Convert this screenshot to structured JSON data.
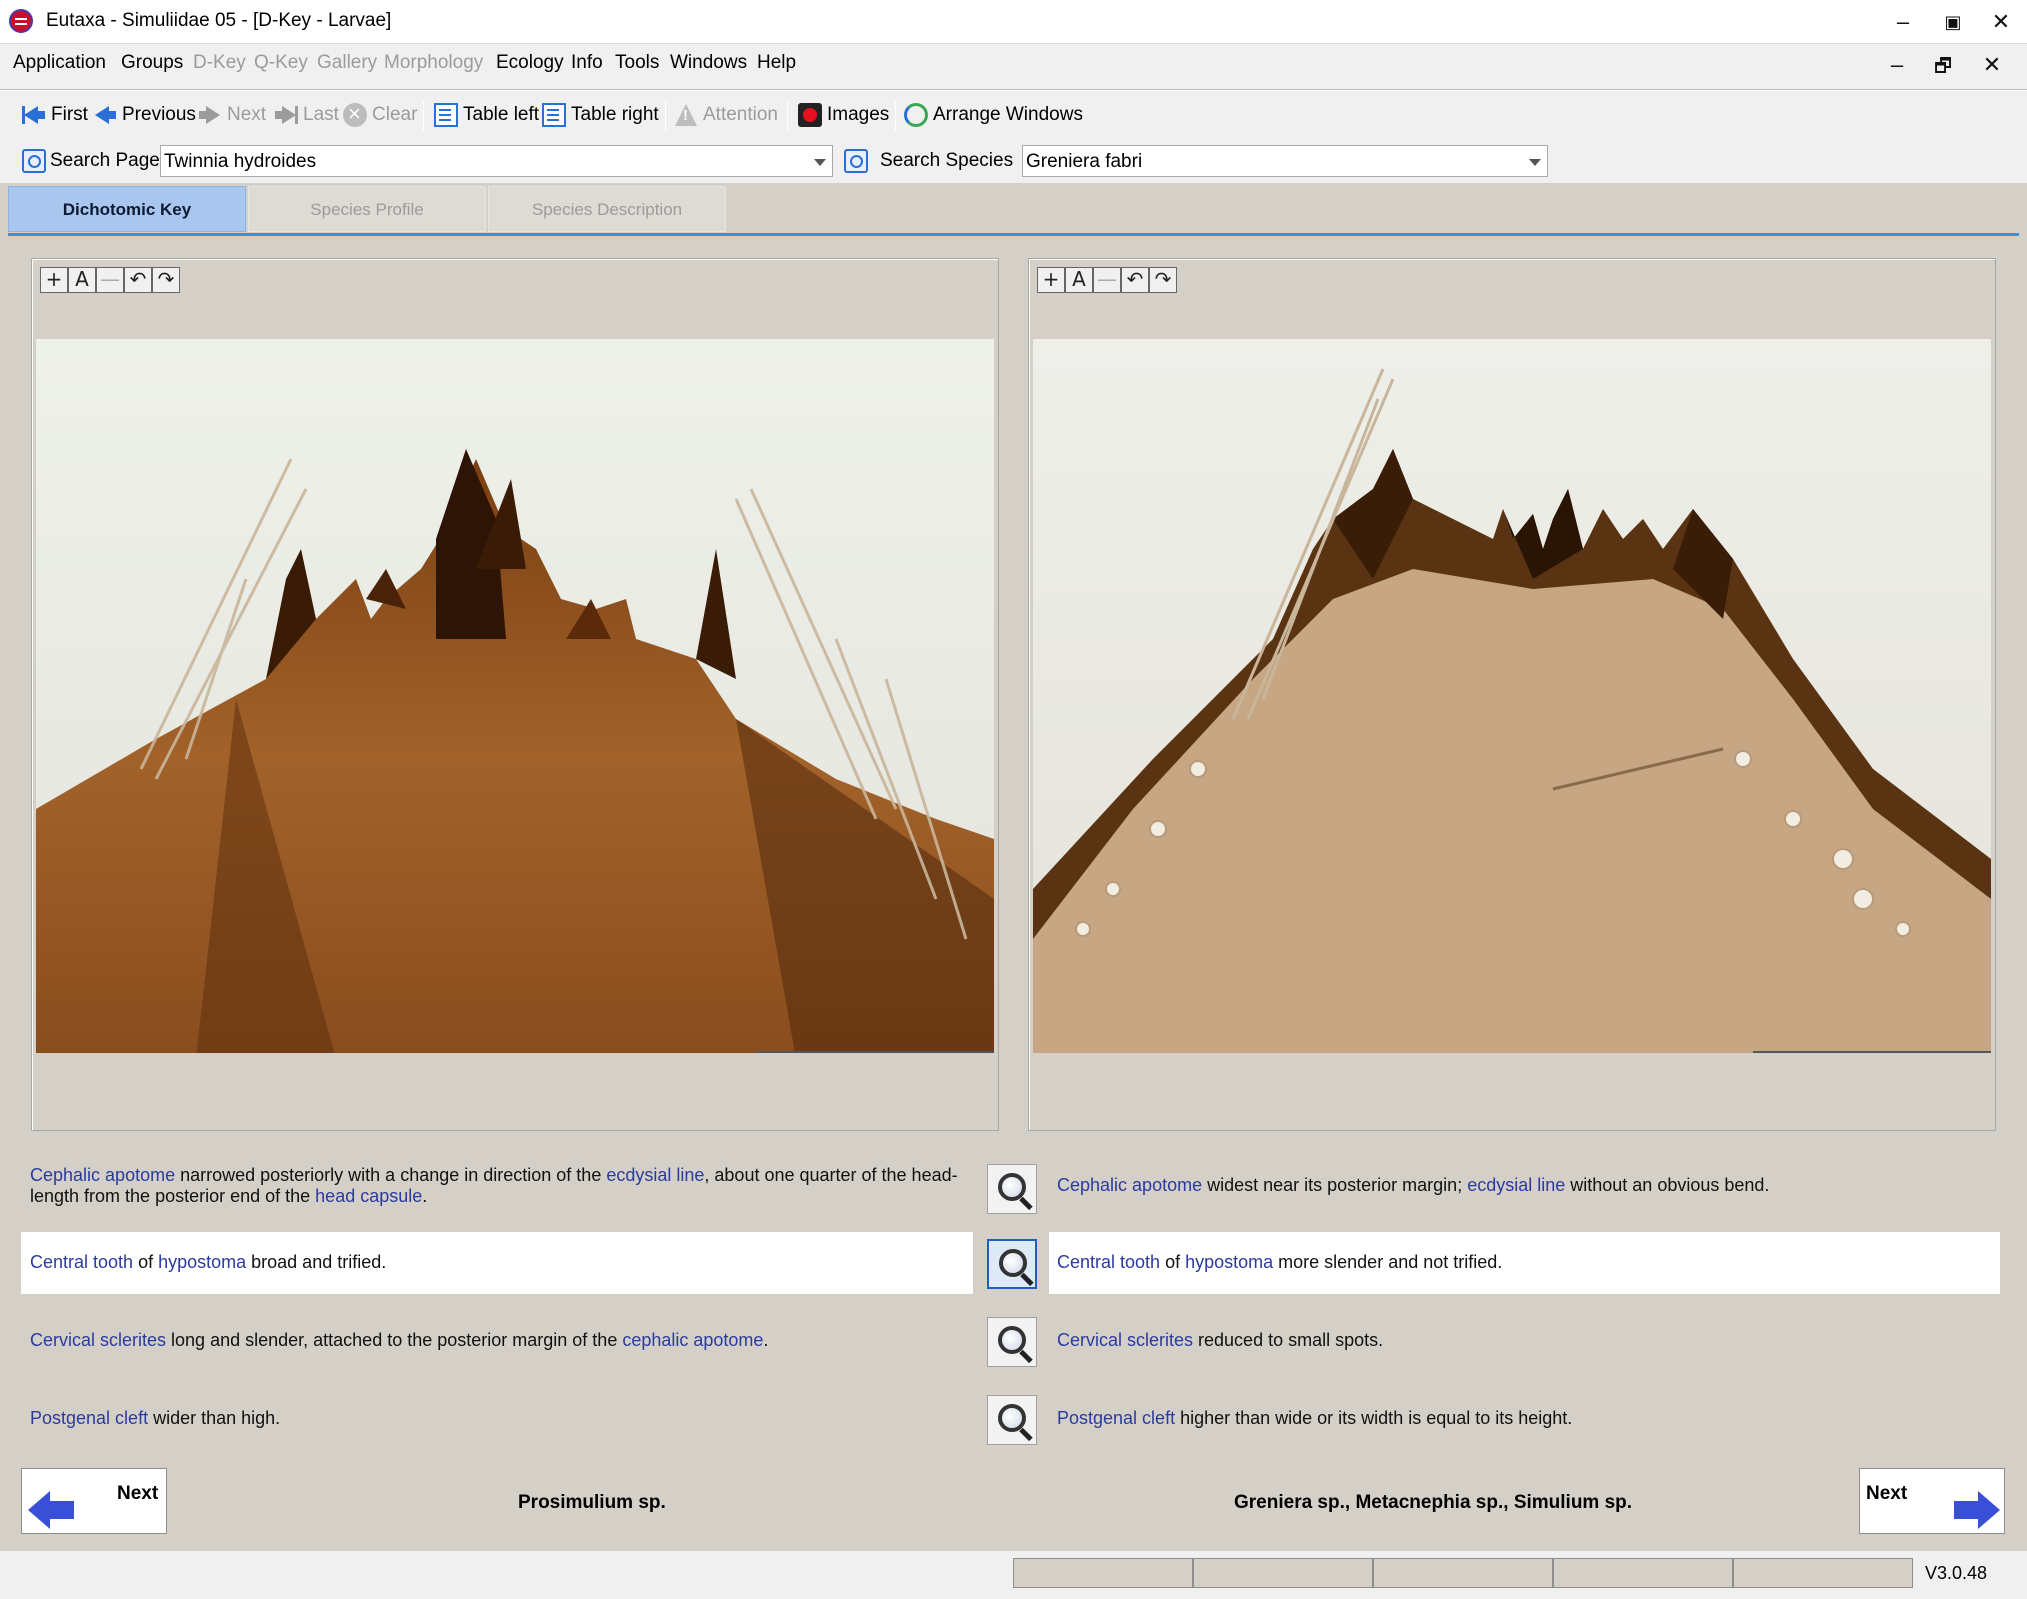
{
  "window": {
    "title": "Eutaxa - Simuliidae 05 - [D-Key - Larvae]",
    "minimize": "–",
    "maximize": "▣",
    "close": "✕"
  },
  "menu": {
    "items": [
      {
        "label": "Application",
        "enabled": true
      },
      {
        "label": "Groups",
        "enabled": true
      },
      {
        "label": "D-Key",
        "enabled": false
      },
      {
        "label": "Q-Key",
        "enabled": false
      },
      {
        "label": "Gallery",
        "enabled": false
      },
      {
        "label": "Morphology",
        "enabled": false
      },
      {
        "label": "Ecology",
        "enabled": true
      },
      {
        "label": "Info",
        "enabled": true
      },
      {
        "label": "Tools",
        "enabled": true
      },
      {
        "label": "Windows",
        "enabled": true
      },
      {
        "label": "Help",
        "enabled": true
      }
    ],
    "mdi": {
      "minimize": "–",
      "restore": "🗗",
      "close": "✕"
    }
  },
  "toolbar": {
    "first": "First",
    "previous": "Previous",
    "next": "Next",
    "last": "Last",
    "clear": "Clear",
    "table_left": "Table left",
    "table_right": "Table right",
    "attention": "Attention",
    "images": "Images",
    "arrange": "Arrange Windows"
  },
  "search": {
    "page_label": "Search Page",
    "page_value": "Twinnia hydroides",
    "species_label": "Search Species",
    "species_value": "Greniera fabri"
  },
  "tabs": [
    {
      "label": "Dichotomic Key",
      "active": true
    },
    {
      "label": "Species Profile",
      "active": false
    },
    {
      "label": "Species Description",
      "active": false
    }
  ],
  "zoom_tools": {
    "zoom_in": "+",
    "auto": "A",
    "zoom_out": "—",
    "rotate_left": "↶",
    "rotate_right": "↷"
  },
  "key": {
    "left": [
      [
        {
          "t": "Cephalic apotome",
          "link": true
        },
        {
          "t": " narrowed posteriorly with a change in direction of the ",
          "link": false
        },
        {
          "t": "ecdysial line",
          "link": true
        },
        {
          "t": ", about one quarter of the head-length from the posterior end of the ",
          "link": false
        },
        {
          "t": "head capsule",
          "link": true
        },
        {
          "t": ".",
          "link": false
        }
      ],
      [
        {
          "t": "Central tooth",
          "link": true
        },
        {
          "t": " of ",
          "link": false
        },
        {
          "t": "hypostoma",
          "link": true
        },
        {
          "t": " broad and trified.",
          "link": false
        }
      ],
      [
        {
          "t": "Cervical sclerites",
          "link": true
        },
        {
          "t": " long and slender, attached to the posterior margin of the ",
          "link": false
        },
        {
          "t": "cephalic apotome",
          "link": true
        },
        {
          "t": ".",
          "link": false
        }
      ],
      [
        {
          "t": "Postgenal cleft",
          "link": true
        },
        {
          "t": " wider than high.",
          "link": false
        }
      ]
    ],
    "right": [
      [
        {
          "t": "Cephalic apotome",
          "link": true
        },
        {
          "t": " widest near its posterior margin; ",
          "link": false
        },
        {
          "t": "ecdysial line",
          "link": true
        },
        {
          "t": " without an obvious bend.",
          "link": false
        }
      ],
      [
        {
          "t": "Central tooth",
          "link": true
        },
        {
          "t": " of ",
          "link": false
        },
        {
          "t": "hypostoma",
          "link": true
        },
        {
          "t": " more slender and not trified.",
          "link": false
        }
      ],
      [
        {
          "t": "Cervical sclerites",
          "link": true
        },
        {
          "t": " reduced to small spots.",
          "link": false
        }
      ],
      [
        {
          "t": "Postgenal cleft",
          "link": true
        },
        {
          "t": " higher than wide or its width is equal to its height.",
          "link": false
        }
      ]
    ],
    "selected_row": 1
  },
  "nav": {
    "left_label": "Next",
    "right_label": "Next",
    "left_result": "Prosimulium sp.",
    "right_result": "Greniera sp., Metacnephia sp., Simulium sp."
  },
  "status": {
    "version": "V3.0.48"
  },
  "colors": {
    "link": "#2b3aa0",
    "accent": "#3f8fd6",
    "arrow": "#3a4fd8"
  }
}
